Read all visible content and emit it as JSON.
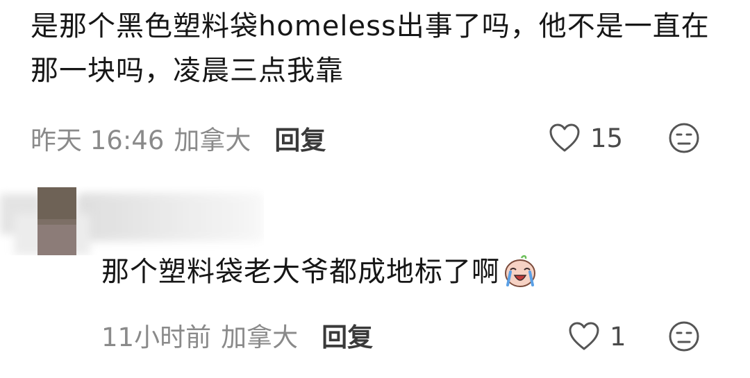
{
  "comments": [
    {
      "text": "是那个黑色塑料袋homeless出事了吗，他不是一直在那一块吗，凌晨三点我靠",
      "time": "昨天 16:46",
      "location": "加拿大",
      "reply_label": "回复",
      "like_count": "15",
      "icons": {
        "like": "heart-outline-icon",
        "dislike": "neutral-face-icon"
      }
    },
    {
      "text": "那个塑料袋老大爷都成地标了啊",
      "time": "11小时前",
      "location": "加拿大",
      "reply_label": "回复",
      "like_count": "1",
      "icons": {
        "emoji": "crying-laughing-sticker-icon",
        "like": "heart-outline-icon",
        "dislike": "neutral-face-icon"
      }
    }
  ]
}
